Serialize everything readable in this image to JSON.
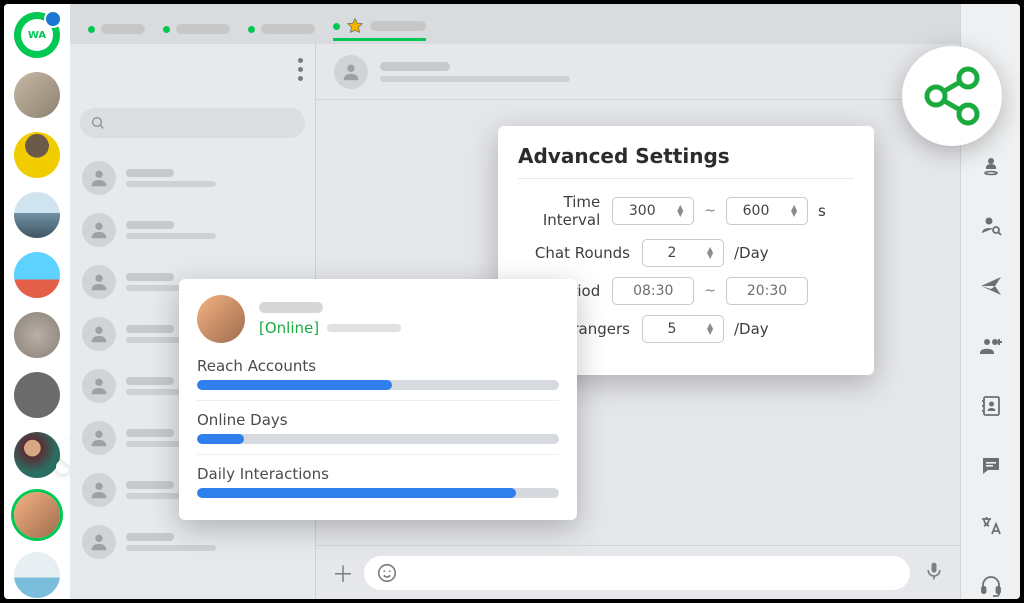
{
  "logo_text": "WA",
  "search_placeholder": "",
  "colors": {
    "accent_green": "#00c853",
    "share_green": "#1aab3e",
    "progress_blue": "#2f80ed"
  },
  "metrics": {
    "status": "[Online]",
    "items": [
      {
        "label": "Reach Accounts",
        "percent": 54
      },
      {
        "label": "Online Days",
        "percent": 13
      },
      {
        "label": "Daily Interactions",
        "percent": 88
      }
    ]
  },
  "settings": {
    "title": "Advanced Settings",
    "rows": [
      {
        "label": "Time Interval",
        "min": "300",
        "max": "600",
        "suffix": "s"
      },
      {
        "label": "Chat Rounds",
        "value": "2",
        "suffix": "/Day"
      },
      {
        "label": "Period",
        "start": "08:30",
        "end": "20:30"
      },
      {
        "label": "Strangers",
        "value": "5",
        "suffix": "/Day"
      }
    ]
  },
  "right_rail_icons": [
    "location-pin-icon",
    "person-search-icon",
    "send-icon",
    "group-add-icon",
    "contacts-book-icon",
    "quick-reply-icon",
    "translate-icon",
    "support-headset-icon"
  ]
}
